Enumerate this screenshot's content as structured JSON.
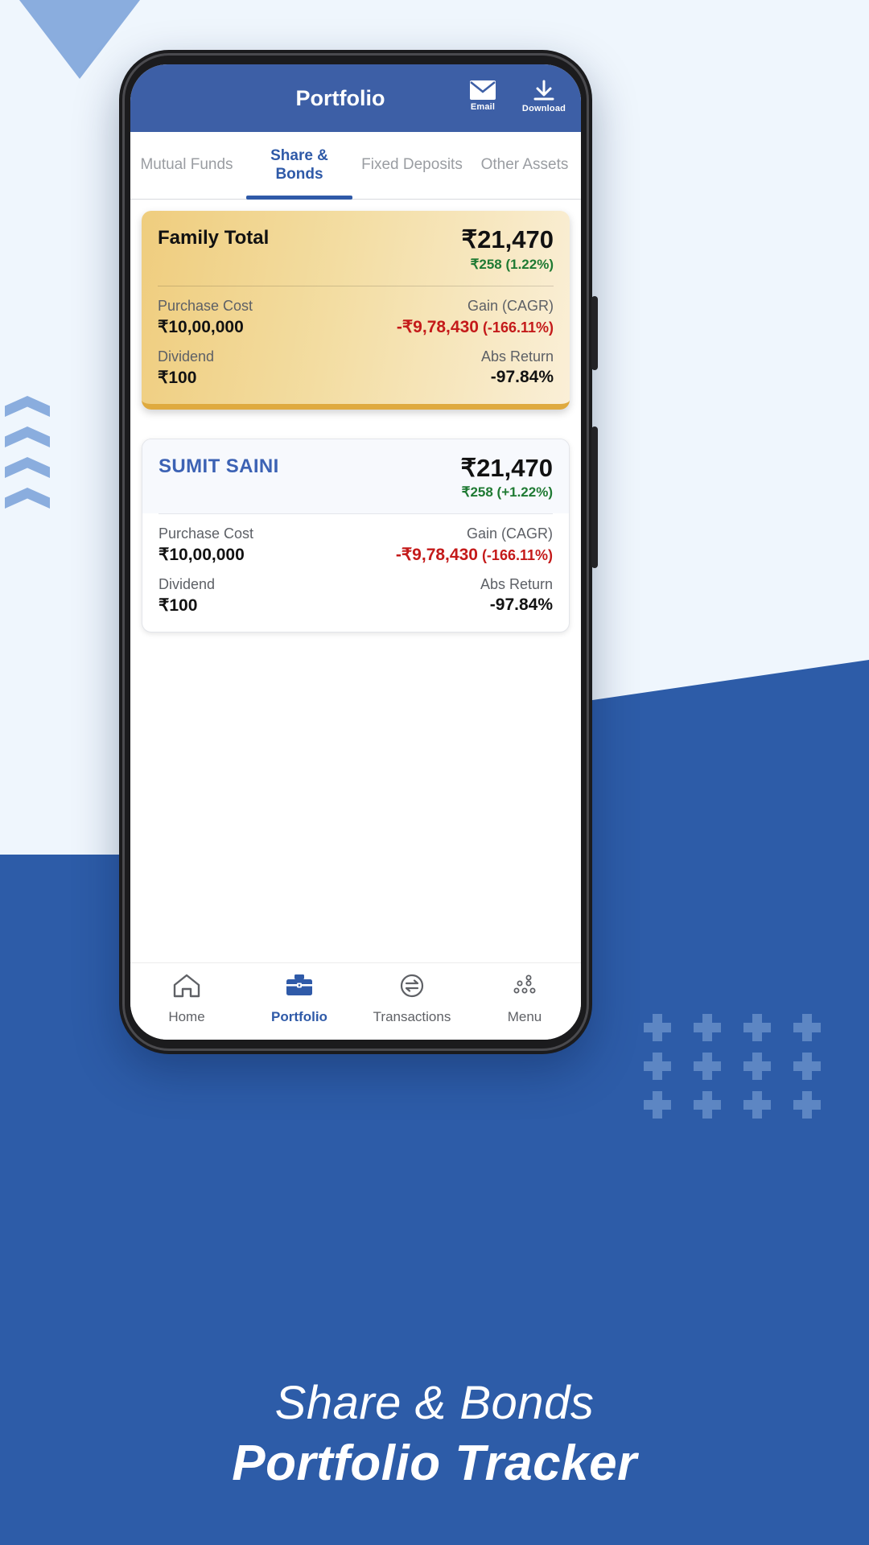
{
  "app": {
    "header": {
      "title": "Portfolio",
      "actions": [
        {
          "label": "Email",
          "icon": "email-icon"
        },
        {
          "label": "Download",
          "icon": "download-icon"
        }
      ]
    },
    "tabs": [
      {
        "label": "Mutual Funds",
        "active": false
      },
      {
        "label": "Share & Bonds",
        "active": true
      },
      {
        "label": "Fixed Deposits",
        "active": false
      },
      {
        "label": "Other Assets",
        "active": false
      }
    ],
    "cards": [
      {
        "name": "Family Total",
        "total": "₹21,470",
        "delta": "₹258 (1.22%)",
        "stats": [
          {
            "label": "Purchase Cost",
            "value": "₹10,00,000",
            "label_r": "Gain (CAGR)",
            "value_r": "-₹9,78,430",
            "value_r_pct": " (-166.11%)"
          },
          {
            "label": "Dividend",
            "value": "₹100",
            "label_r": "Abs Return",
            "value_r": "-97.84%",
            "value_r_pct": ""
          }
        ]
      },
      {
        "name": "SUMIT SAINI",
        "total": "₹21,470",
        "delta": "₹258 (+1.22%)",
        "stats": [
          {
            "label": "Purchase Cost",
            "value": "₹10,00,000",
            "label_r": "Gain (CAGR)",
            "value_r": "-₹9,78,430",
            "value_r_pct": " (-166.11%)"
          },
          {
            "label": "Dividend",
            "value": "₹100",
            "label_r": "Abs Return",
            "value_r": "-97.84%",
            "value_r_pct": ""
          }
        ]
      }
    ],
    "bottom_nav": [
      {
        "label": "Home",
        "icon": "home-icon",
        "active": false
      },
      {
        "label": "Portfolio",
        "icon": "briefcase-icon",
        "active": true
      },
      {
        "label": "Transactions",
        "icon": "exchange-icon",
        "active": false
      },
      {
        "label": "Menu",
        "icon": "dots-menu-icon",
        "active": false
      }
    ]
  },
  "banner": {
    "line1": "Share & Bonds",
    "line2": "Portfolio Tracker"
  },
  "colors": {
    "brand_blue": "#3d5fa6",
    "accent_blue": "#2f5aa8",
    "bg_blue": "#2d5ca8",
    "gold": "#efcd7e",
    "gain_green": "#1f7a33",
    "loss_red": "#c41a1a"
  }
}
